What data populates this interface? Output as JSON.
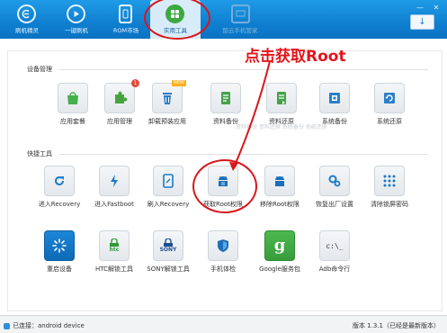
{
  "toolbar": {
    "tabs": [
      {
        "label": "刷机精灵",
        "icon": "logo-icon"
      },
      {
        "label": "一键刷机",
        "icon": "play-icon"
      },
      {
        "label": "ROM市场",
        "icon": "phone-icon"
      },
      {
        "label": "实用工具",
        "icon": "grid-icon",
        "active": true
      },
      {
        "label": "酷云手机管家",
        "icon": "monitor-icon",
        "dim": true
      }
    ],
    "minimize_label": "—",
    "close_label": "✕",
    "download_label": "↓"
  },
  "annotation": {
    "text": "点击获取Root"
  },
  "sections": {
    "device_management": {
      "title": "设备管理",
      "items": [
        {
          "label": "应用套餐",
          "icon": "shopping-bag-icon"
        },
        {
          "label": "应用管理",
          "icon": "puzzle-icon",
          "badge": "1"
        },
        {
          "label": "卸载预装应用",
          "icon": "trash-icon",
          "tag": "NEW"
        },
        {
          "label": "资料备份",
          "icon": "contact-backup-icon"
        },
        {
          "label": "资料还原",
          "icon": "contact-restore-icon"
        },
        {
          "label": "系统备份",
          "icon": "system-backup-icon"
        },
        {
          "label": "系统还原",
          "icon": "system-restore-icon"
        }
      ]
    },
    "quick_tools": {
      "title": "快捷工具",
      "items_row1": [
        {
          "label": "进入Recovery",
          "icon": "refresh-icon"
        },
        {
          "label": "进入Fastboot",
          "icon": "bolt-icon"
        },
        {
          "label": "刷入Recovery",
          "icon": "tablet-icon"
        },
        {
          "label": "获取Root权限",
          "icon": "android-root-icon"
        },
        {
          "label": "移除Root权限",
          "icon": "android-unroot-icon"
        },
        {
          "label": "恢复出厂设置",
          "icon": "gears-icon"
        },
        {
          "label": "清除锁屏密码",
          "icon": "pattern-lock-icon"
        }
      ],
      "items_row2": [
        {
          "label": "重启设备",
          "icon": "spinner-icon"
        },
        {
          "label": "HTC解锁工具",
          "icon": "htc-lock-icon",
          "brand": "htc"
        },
        {
          "label": "SONY解锁工具",
          "icon": "sony-lock-icon",
          "brand": "SONY"
        },
        {
          "label": "手机体检",
          "icon": "shield-icon"
        },
        {
          "label": "Google服务包",
          "icon": "google-icon",
          "brand": "g"
        },
        {
          "label": "Adb命令行",
          "icon": "terminal-icon",
          "brand": "c:\\_"
        }
      ]
    }
  },
  "watermark": "资料备份 资料还原 系统备份 系统还原",
  "status": {
    "connection": "已连接：android device",
    "version": "版本 1.3.1（已经是最新版本）"
  },
  "colors": {
    "toolbar_blue": "#0f7fd0",
    "annotation_red": "#d8161b",
    "tile_blue": "#0d6ab7",
    "tile_grey": "#e4e8ec",
    "google_green": "#379d3b"
  }
}
